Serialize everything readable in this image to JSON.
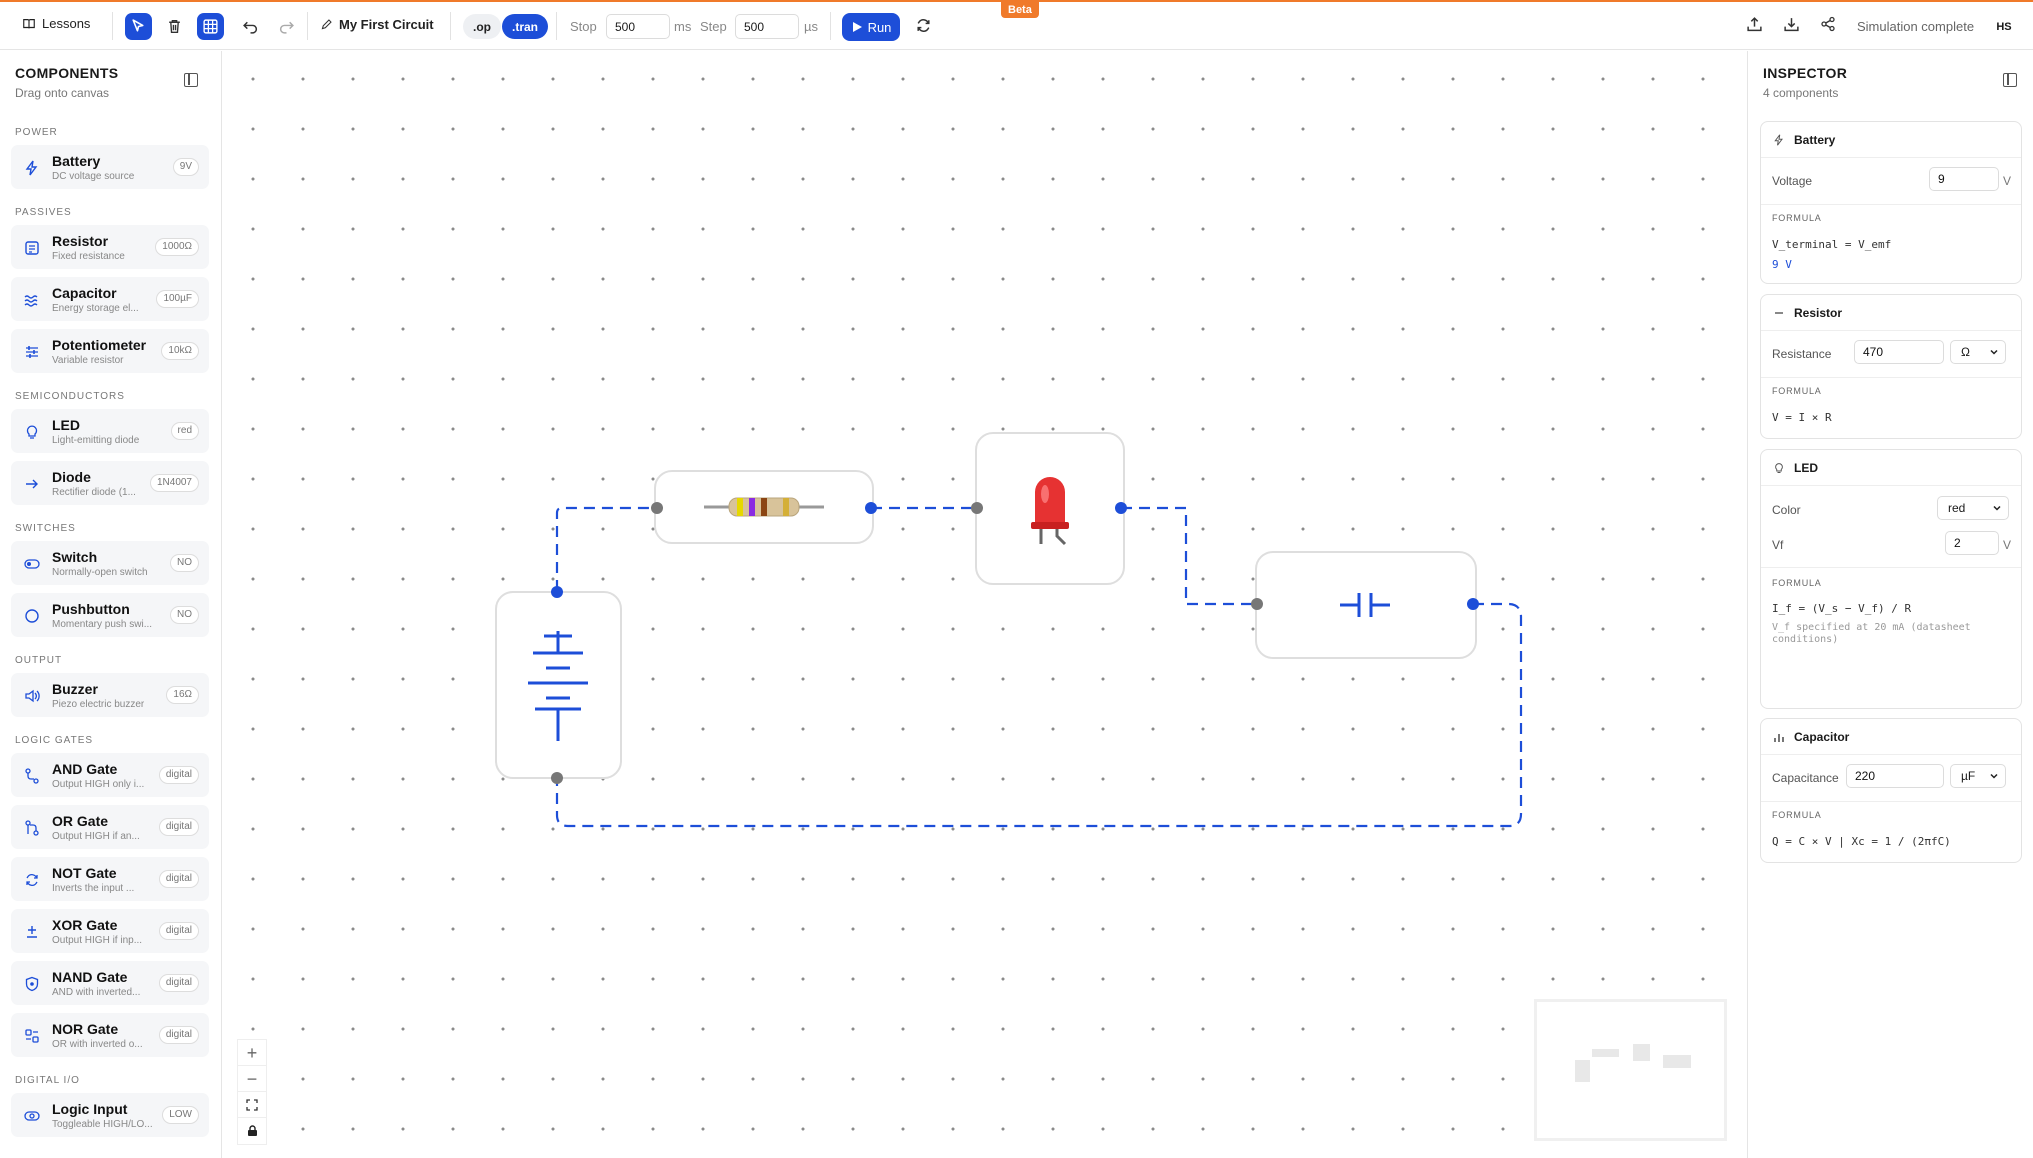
{
  "topbar": {
    "lessons_label": "Lessons",
    "circuit_name": "My First Circuit",
    "mode_op": ".op",
    "mode_tran": ".tran",
    "stop_label": "Stop",
    "stop_value": "500",
    "stop_unit": "ms",
    "step_label": "Step",
    "step_value": "500",
    "step_unit": "µs",
    "run_label": "Run",
    "beta_label": "Beta",
    "status": "Simulation complete",
    "avatar": "HS"
  },
  "components_panel": {
    "title": "COMPONENTS",
    "subtitle": "Drag onto canvas",
    "sections": [
      {
        "heading": "POWER",
        "items": [
          {
            "name": "Battery",
            "desc": "DC voltage source",
            "badge": "9V",
            "icon": "bolt-icon"
          }
        ]
      },
      {
        "heading": "PASSIVES",
        "items": [
          {
            "name": "Resistor",
            "desc": "Fixed resistance",
            "badge": "1000Ω",
            "icon": "resistor-icon"
          },
          {
            "name": "Capacitor",
            "desc": "Energy storage el...",
            "badge": "100µF",
            "icon": "waves-icon"
          },
          {
            "name": "Potentiometer",
            "desc": "Variable resistor",
            "badge": "10kΩ",
            "icon": "sliders-icon"
          }
        ]
      },
      {
        "heading": "SEMICONDUCTORS",
        "items": [
          {
            "name": "LED",
            "desc": "Light-emitting diode",
            "badge": "red",
            "icon": "bulb-icon"
          },
          {
            "name": "Diode",
            "desc": "Rectifier diode (1...",
            "badge": "1N4007",
            "icon": "arrow-right-icon"
          }
        ]
      },
      {
        "heading": "SWITCHES",
        "items": [
          {
            "name": "Switch",
            "desc": "Normally-open switch",
            "badge": "NO",
            "icon": "toggle-icon"
          },
          {
            "name": "Pushbutton",
            "desc": "Momentary push swi...",
            "badge": "NO",
            "icon": "circle-icon"
          }
        ]
      },
      {
        "heading": "OUTPUT",
        "items": [
          {
            "name": "Buzzer",
            "desc": "Piezo electric buzzer",
            "badge": "16Ω",
            "icon": "speaker-icon"
          }
        ]
      },
      {
        "heading": "LOGIC GATES",
        "items": [
          {
            "name": "AND Gate",
            "desc": "Output HIGH only i...",
            "badge": "digital",
            "icon": "route-icon"
          },
          {
            "name": "OR Gate",
            "desc": "Output HIGH if an...",
            "badge": "digital",
            "icon": "git-icon"
          },
          {
            "name": "NOT Gate",
            "desc": "Inverts the input ...",
            "badge": "digital",
            "icon": "cycle-icon"
          },
          {
            "name": "XOR Gate",
            "desc": "Output HIGH if inp...",
            "badge": "digital",
            "icon": "plus-minus-icon"
          },
          {
            "name": "NAND Gate",
            "desc": "AND with inverted...",
            "badge": "digital",
            "icon": "shield-icon"
          },
          {
            "name": "NOR Gate",
            "desc": "OR with inverted o...",
            "badge": "digital",
            "icon": "grid-icon"
          }
        ]
      },
      {
        "heading": "DIGITAL I/O",
        "items": [
          {
            "name": "Logic Input",
            "desc": "Toggleable HIGH/LO...",
            "badge": "LOW",
            "icon": "eye-toggle-icon"
          }
        ]
      }
    ]
  },
  "inspector": {
    "title": "INSPECTOR",
    "subtitle": "4 components",
    "formula_label": "FORMULA",
    "battery": {
      "title": "Battery",
      "prop": "Voltage",
      "value": "9",
      "unit": "V",
      "formula": "V_terminal = V_emf",
      "result": "9 V"
    },
    "resistor": {
      "title": "Resistor",
      "prop": "Resistance",
      "value": "470",
      "unit": "Ω",
      "formula": "V = I × R"
    },
    "led": {
      "title": "LED",
      "color_prop": "Color",
      "color_value": "red",
      "vf_prop": "Vf",
      "vf_value": "2",
      "vf_unit": "V",
      "formula": "I_f = (V_s − V_f) / R",
      "note": "V_f specified at 20 mA (datasheet conditions)"
    },
    "capacitor": {
      "title": "Capacitor",
      "prop": "Capacitance",
      "value": "220",
      "unit": "µF",
      "formula": "Q = C × V | Xc = 1 / (2πfC)"
    }
  },
  "colors": {
    "accent": "#1d4ed8",
    "beta": "#f07a2a",
    "wire": "#1d4ed8"
  }
}
